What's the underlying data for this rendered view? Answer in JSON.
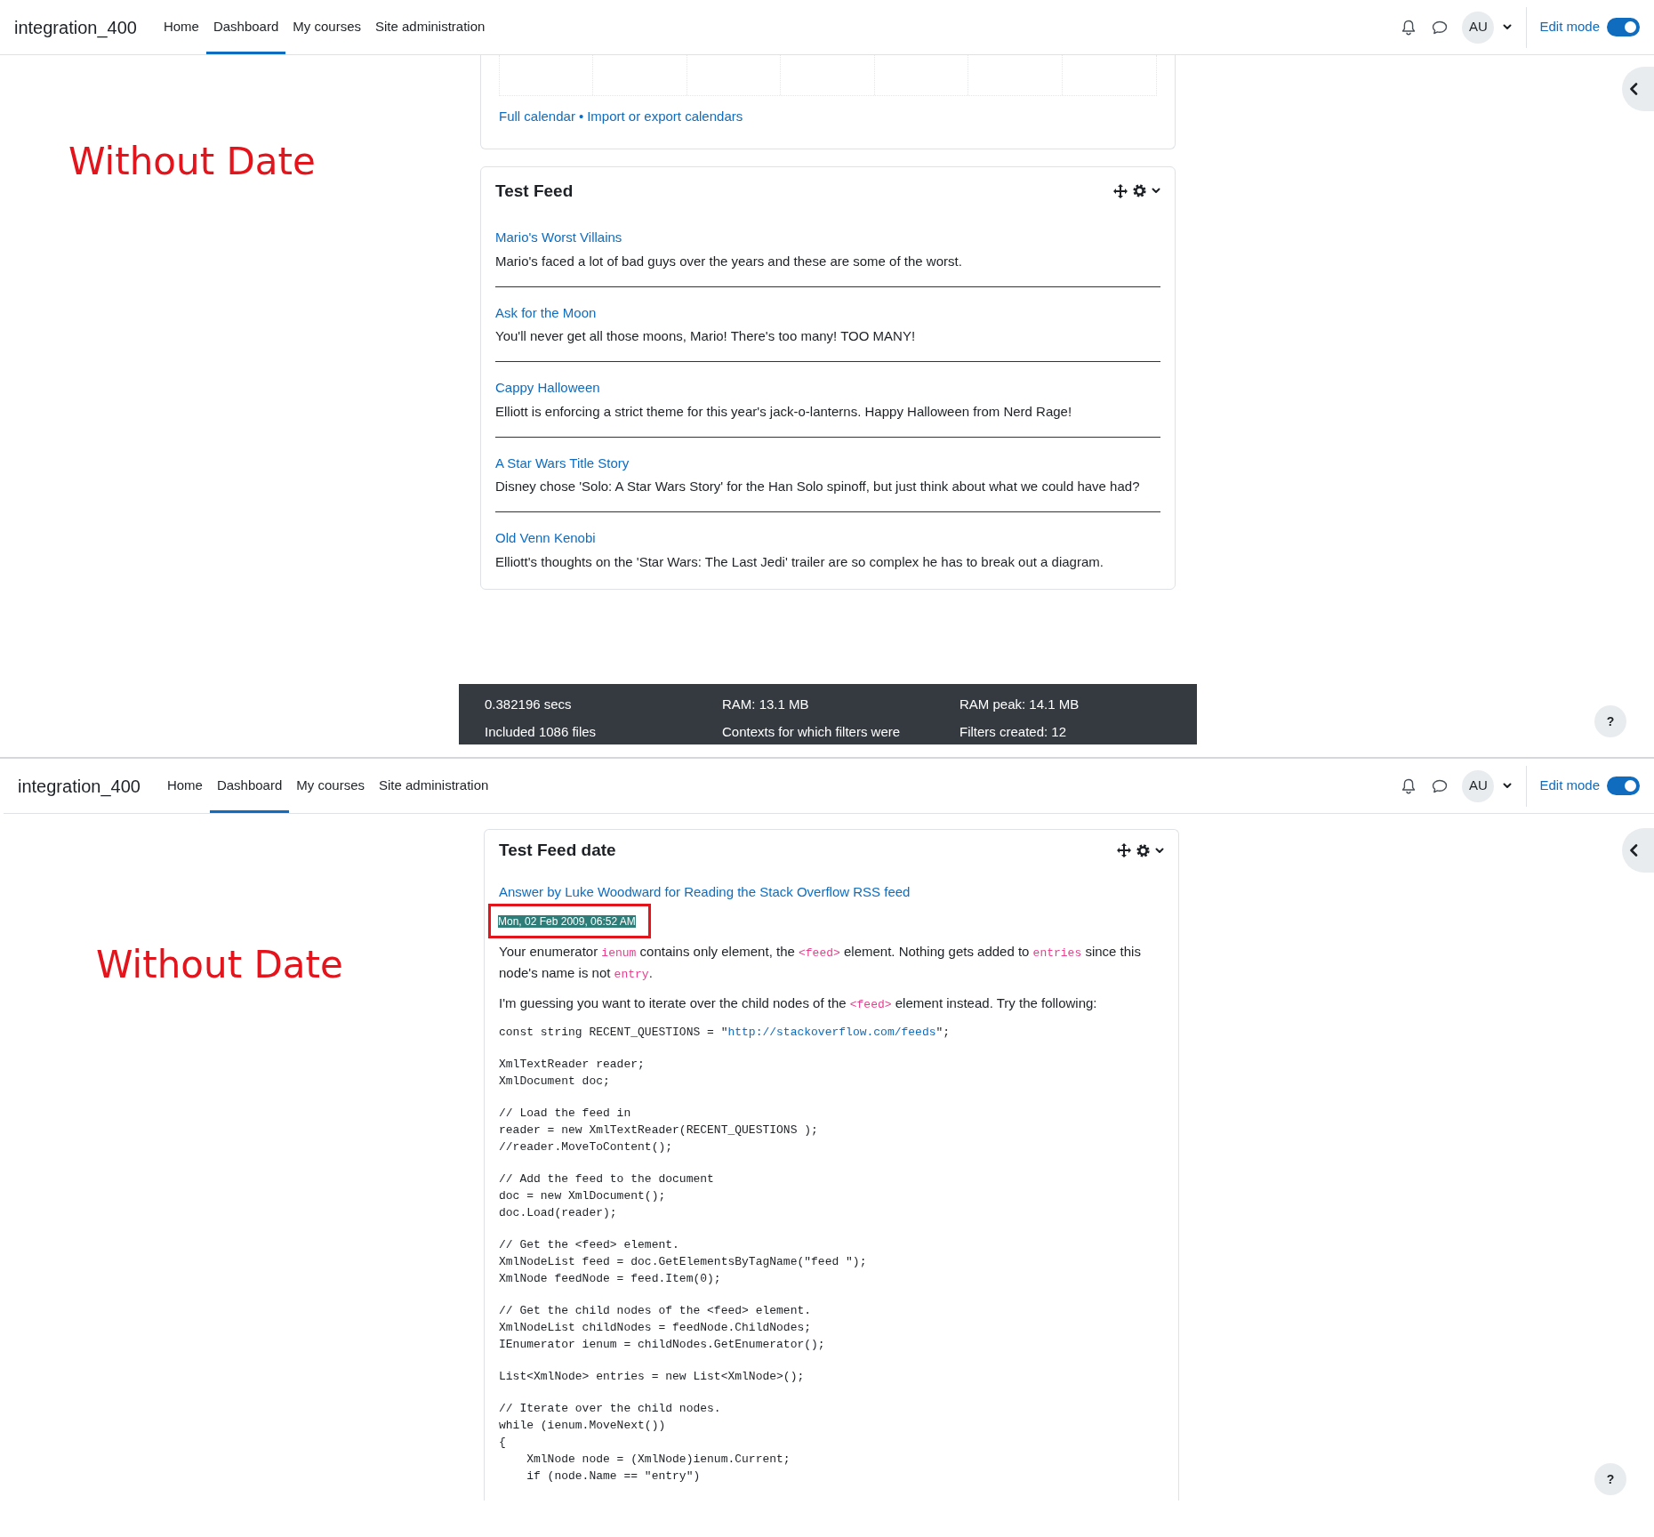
{
  "panels": [
    {
      "navbar": {
        "brand": "integration_400",
        "nav_items": [
          {
            "label": "Home",
            "selected": false
          },
          {
            "label": "Dashboard",
            "selected": true
          },
          {
            "label": "My courses",
            "selected": false
          },
          {
            "label": "Site administration",
            "selected": false
          }
        ],
        "avatar": "AU",
        "edit_mode": {
          "label": "Edit mode",
          "on": true
        }
      },
      "annotation": "Without Date",
      "calendar": {
        "links": [
          "Full calendar",
          "Import or export calendars"
        ],
        "separator": "•"
      },
      "block": {
        "title": "Test Feed",
        "items": [
          {
            "title": "Mario's Worst Villains",
            "description": "Mario's faced a lot of bad guys over the years and these are some of the worst."
          },
          {
            "title": "Ask for the Moon",
            "description": "You'll never get all those moons, Mario! There's too many! TOO MANY!"
          },
          {
            "title": "Cappy Halloween",
            "description": "Elliott is enforcing a strict theme for this year's jack-o-lanterns. Happy Halloween from Nerd Rage!"
          },
          {
            "title": "A Star Wars Title Story",
            "description": "Disney chose 'Solo: A Star Wars Story' for the Han Solo spinoff, but just think about what we could have had?"
          },
          {
            "title": "Old Venn Kenobi",
            "description": "Elliott's thoughts on the 'Star Wars: The Last Jedi' trailer are so complex he has to break out a diagram."
          }
        ]
      },
      "footer": {
        "cells": [
          "0.382196 secs",
          "RAM: 13.1 MB",
          "RAM peak: 14.1 MB",
          "Included 1086 files",
          "Contexts for which filters were",
          "Filters created: 12"
        ]
      },
      "help": "?"
    },
    {
      "navbar": {
        "brand": "integration_400",
        "nav_items": [
          {
            "label": "Home",
            "selected": false
          },
          {
            "label": "Dashboard",
            "selected": true
          },
          {
            "label": "My courses",
            "selected": false
          },
          {
            "label": "Site administration",
            "selected": false
          }
        ],
        "avatar": "AU",
        "edit_mode": {
          "label": "Edit mode",
          "on": true
        }
      },
      "annotation": "Without Date",
      "block": {
        "title": "Test Feed date",
        "items": [
          {
            "title": "Answer by Luke Woodward for Reading the Stack Overflow RSS feed",
            "date": {
              "text": "Mon, 02 Feb 2009, 06:52 AM",
              "selected": true,
              "marked": true
            },
            "paragraphs": [
              [
                {
                  "text": "Your enumerator ",
                  "kind": "text"
                },
                {
                  "text": "ienum",
                  "kind": "code"
                },
                {
                  "text": " contains only element, the ",
                  "kind": "text"
                },
                {
                  "text": "<feed>",
                  "kind": "code"
                },
                {
                  "text": " element. Nothing gets added to ",
                  "kind": "text"
                },
                {
                  "text": "entries",
                  "kind": "code"
                },
                {
                  "text": " since this node's name is not ",
                  "kind": "text"
                },
                {
                  "text": "entry",
                  "kind": "code"
                },
                {
                  "text": ".",
                  "kind": "text"
                }
              ],
              [
                {
                  "text": "I'm guessing you want to iterate over the child nodes of the ",
                  "kind": "text"
                },
                {
                  "text": "<feed>",
                  "kind": "code"
                },
                {
                  "text": " element instead. Try the following:",
                  "kind": "text"
                }
              ]
            ],
            "code_blocks": [
              [
                [
                  {
                    "text": "const string RECENT_QUESTIONS = \"",
                    "kind": "code"
                  },
                  {
                    "text": "http://stackoverflow.com/feeds",
                    "kind": "link"
                  },
                  {
                    "text": "\";",
                    "kind": "code"
                  }
                ]
              ],
              [
                [
                  {
                    "text": "XmlTextReader reader;",
                    "kind": "code"
                  }
                ],
                [
                  {
                    "text": "XmlDocument doc;",
                    "kind": "code"
                  }
                ]
              ],
              [
                [
                  {
                    "text": "// Load the feed in",
                    "kind": "code"
                  }
                ],
                [
                  {
                    "text": "reader = new XmlTextReader(RECENT_QUESTIONS );",
                    "kind": "code"
                  }
                ],
                [
                  {
                    "text": "//reader.MoveToContent();",
                    "kind": "code"
                  }
                ]
              ],
              [
                [
                  {
                    "text": "// Add the feed to the document",
                    "kind": "code"
                  }
                ],
                [
                  {
                    "text": "doc = new XmlDocument();",
                    "kind": "code"
                  }
                ],
                [
                  {
                    "text": "doc.Load(reader);",
                    "kind": "code"
                  }
                ]
              ],
              [
                [
                  {
                    "text": "// Get the <feed> element.",
                    "kind": "code"
                  }
                ],
                [
                  {
                    "text": "XmlNodeList feed = doc.GetElementsByTagName(\"feed \");",
                    "kind": "code"
                  }
                ],
                [
                  {
                    "text": "XmlNode feedNode = feed.Item(0);",
                    "kind": "code"
                  }
                ]
              ],
              [
                [
                  {
                    "text": "// Get the child nodes of the <feed> element.",
                    "kind": "code"
                  }
                ],
                [
                  {
                    "text": "XmlNodeList childNodes = feedNode.ChildNodes;",
                    "kind": "code"
                  }
                ],
                [
                  {
                    "text": "IEnumerator ienum = childNodes.GetEnumerator();",
                    "kind": "code"
                  }
                ]
              ],
              [
                [
                  {
                    "text": "List<XmlNode> entries = new List<XmlNode>();",
                    "kind": "code"
                  }
                ]
              ],
              [
                [
                  {
                    "text": "// Iterate over the child nodes.",
                    "kind": "code"
                  }
                ],
                [
                  {
                    "text": "while (ienum.MoveNext())",
                    "kind": "code"
                  }
                ],
                [
                  {
                    "text": "{",
                    "kind": "code"
                  }
                ],
                [
                  {
                    "text": "    XmlNode node = (XmlNode)ienum.Current;",
                    "kind": "code"
                  }
                ],
                [
                  {
                    "text": "    if (node.Name == \"entry\")",
                    "kind": "code"
                  }
                ]
              ]
            ]
          }
        ]
      },
      "help": "?"
    }
  ]
}
